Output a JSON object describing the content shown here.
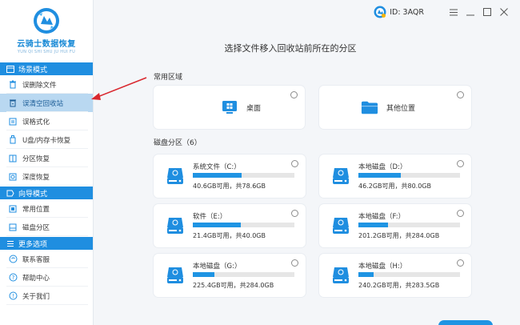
{
  "app": {
    "name": "云骑士数据恢复",
    "subtitle": "YUN QI SHI SHU JU HUI FU"
  },
  "titlebar": {
    "user_id": "ID: 3AQR"
  },
  "sidebar": {
    "sections": [
      {
        "title": "场景模式",
        "items": [
          {
            "label": "误删除文件",
            "icon": "trash-icon"
          },
          {
            "label": "误清空回收站",
            "icon": "recycle-bin-icon",
            "active": true
          },
          {
            "label": "误格式化",
            "icon": "format-icon"
          },
          {
            "label": "U盘/内存卡恢复",
            "icon": "usb-icon"
          },
          {
            "label": "分区恢复",
            "icon": "partition-icon"
          },
          {
            "label": "深度恢复",
            "icon": "deep-scan-icon"
          }
        ]
      },
      {
        "title": "向导模式",
        "items": [
          {
            "label": "常用位置",
            "icon": "location-icon"
          },
          {
            "label": "磁盘分区",
            "icon": "disk-icon"
          }
        ]
      },
      {
        "title": "更多选项",
        "items": [
          {
            "label": "联系客服",
            "icon": "support-icon"
          },
          {
            "label": "帮助中心",
            "icon": "help-icon"
          },
          {
            "label": "关于我们",
            "icon": "info-icon"
          }
        ]
      }
    ]
  },
  "main": {
    "title": "选择文件移入回收站前所在的分区",
    "common_label": "常用区域",
    "locations": [
      {
        "label": "桌面",
        "icon": "desktop-icon"
      },
      {
        "label": "其他位置",
        "icon": "folder-icon"
      }
    ],
    "partition_label": "磁盘分区（6）",
    "partitions": [
      {
        "name": "系统文件（C:）",
        "size_text": "40.6GB可用，共78.6GB",
        "used_fraction": 0.48
      },
      {
        "name": "本地磁盘（D:）",
        "size_text": "46.2GB可用，共80.0GB",
        "used_fraction": 0.42
      },
      {
        "name": "软件（E:）",
        "size_text": "21.4GB可用，共40.0GB",
        "used_fraction": 0.47
      },
      {
        "name": "本地磁盘（F:）",
        "size_text": "201.2GB可用，共284.0GB",
        "used_fraction": 0.29
      },
      {
        "name": "本地磁盘（G:）",
        "size_text": "225.4GB可用，共284.0GB",
        "used_fraction": 0.21
      },
      {
        "name": "本地磁盘（H:）",
        "size_text": "240.2GB可用，共283.5GB",
        "used_fraction": 0.15
      }
    ]
  },
  "colors": {
    "accent": "#1f8ee0",
    "bar_fill": "#1f94e3",
    "active_item": "#b9d8f1",
    "annotation_arrow": "#d9272e"
  }
}
